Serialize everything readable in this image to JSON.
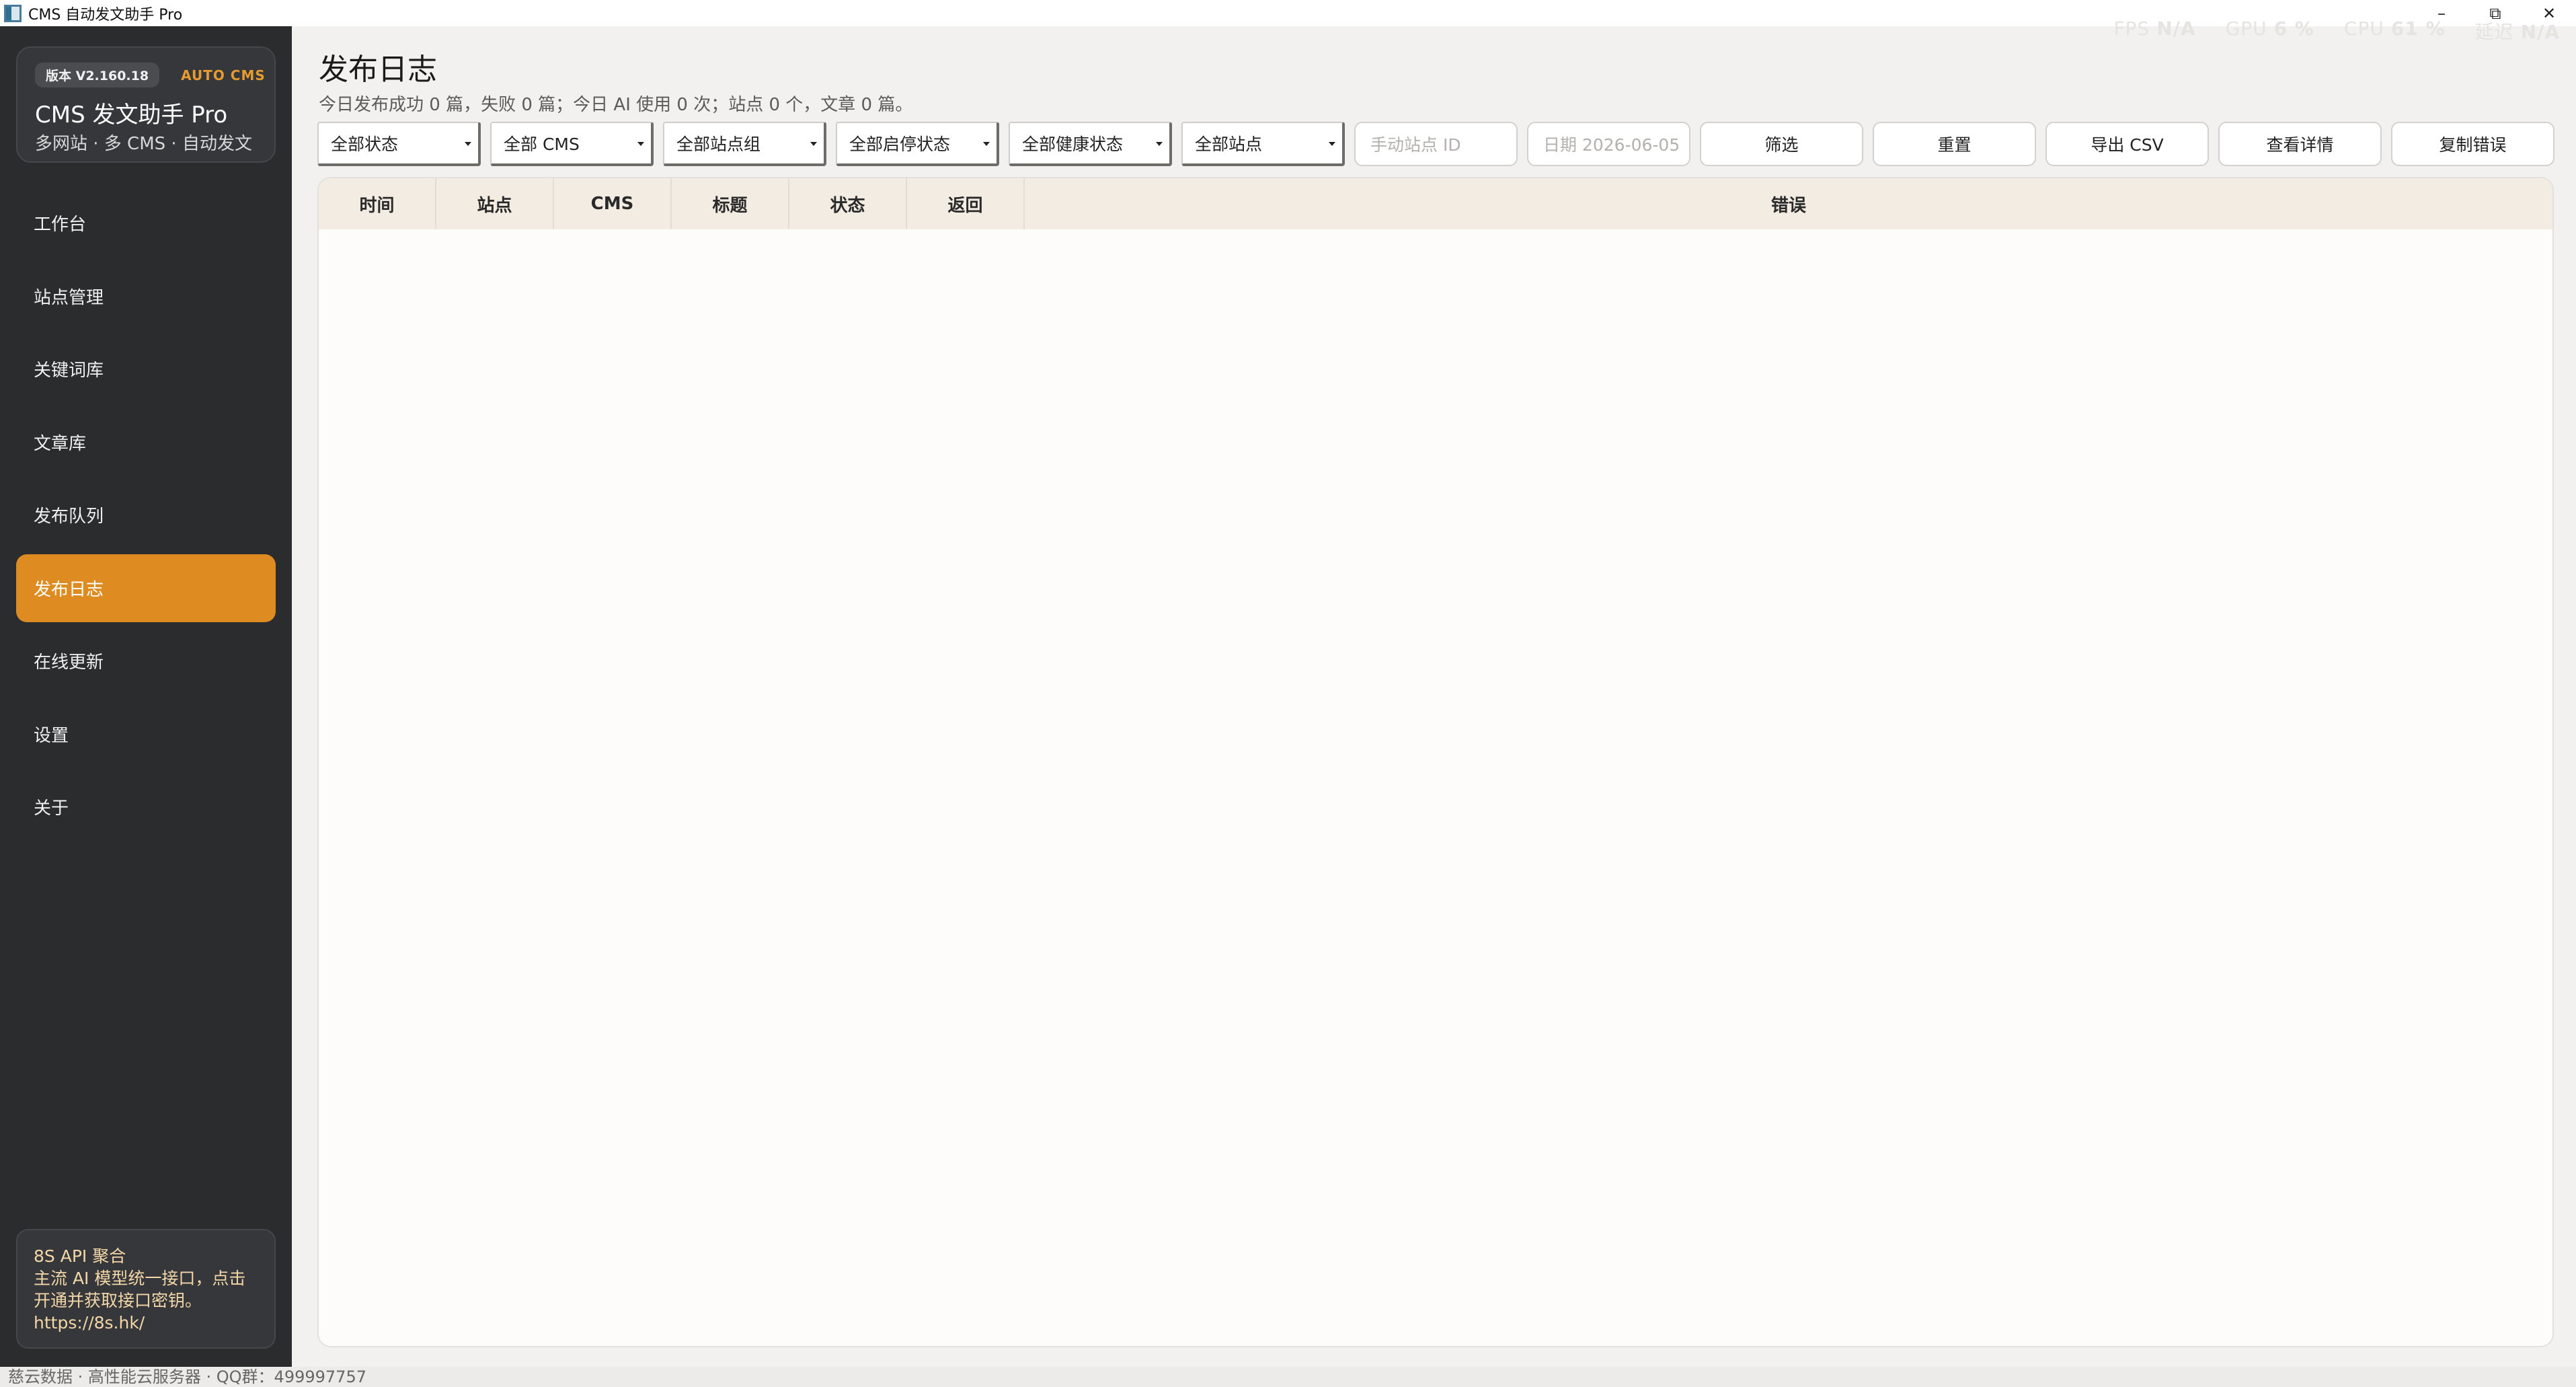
{
  "window": {
    "title": "CMS 自动发文助手 Pro",
    "controls": [
      "–",
      "⧉",
      "✕"
    ]
  },
  "stats": [
    {
      "label": "FPS",
      "value": "N/A"
    },
    {
      "label": "GPU",
      "value": "6 %"
    },
    {
      "label": "CPU",
      "value": "61 %"
    },
    {
      "label": "延迟",
      "value": "N/A"
    }
  ],
  "brand": {
    "version": "版本 V2.160.18",
    "tag": "AUTO CMS",
    "title": "CMS 发文助手 Pro",
    "subtitle": "多网站 · 多 CMS · 自动发文"
  },
  "nav": {
    "items": [
      {
        "label": "工作台",
        "active": false
      },
      {
        "label": "站点管理",
        "active": false
      },
      {
        "label": "关键词库",
        "active": false
      },
      {
        "label": "文章库",
        "active": false
      },
      {
        "label": "发布队列",
        "active": false
      },
      {
        "label": "发布日志",
        "active": true
      },
      {
        "label": "在线更新",
        "active": false
      },
      {
        "label": "设置",
        "active": false
      },
      {
        "label": "关于",
        "active": false
      }
    ]
  },
  "promo": {
    "title": "8S API 聚合",
    "body": "主流 AI 模型统一接口，点击开通并获取接口密钥。",
    "url": "https://8s.hk/"
  },
  "page": {
    "title": "发布日志",
    "summary": "今日发布成功 0 篇，失败 0 篇；今日 AI 使用 0 次；站点 0 个，文章 0 篇。"
  },
  "filters": {
    "status": "全部状态",
    "cms": "全部 CMS",
    "site_group": "全部站点组",
    "enable_status": "全部启停状态",
    "health_status": "全部健康状态",
    "site": "全部站点",
    "site_id_placeholder": "手动站点 ID",
    "date_placeholder": "日期 2026-06-05"
  },
  "buttons": {
    "filter": "筛选",
    "reset": "重置",
    "export": "导出 CSV",
    "details": "查看详情",
    "copy_error": "复制错误"
  },
  "table": {
    "columns": [
      "时间",
      "站点",
      "CMS",
      "标题",
      "状态",
      "返回",
      "错误"
    ],
    "rows": []
  },
  "statusbar": {
    "text": "慈云数据 · 高性能云服务器 · QQ群：499997757"
  },
  "colors": {
    "accent": "#de8c22",
    "sidebar": "#2a2c2e",
    "header_row": "#f2ece3"
  }
}
